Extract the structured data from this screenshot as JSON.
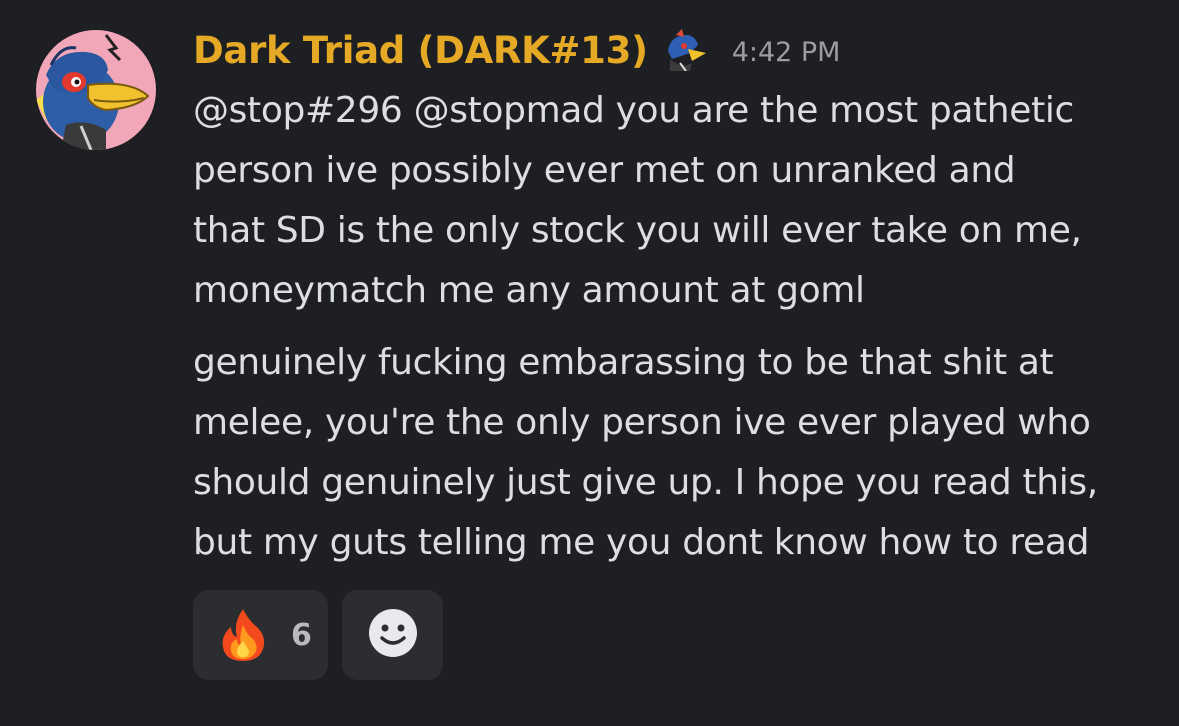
{
  "message": {
    "author": "Dark Triad (DARK#13)",
    "author_color": "#e5a926",
    "author_badge_icon": "falco-icon",
    "avatar_icon": "falco-avatar",
    "timestamp": "4:42 PM",
    "paragraphs": [
      {
        "lines": [
          "@stop#296 @stopmad you are the most pathetic",
          "person ive possibly ever met on unranked and",
          "that SD is the only stock you will ever take on me,",
          "moneymatch me any amount at goml"
        ]
      },
      {
        "lines": [
          "genuinely fucking embarassing to be that shit at",
          "melee, you're the only person ive ever played who",
          "should genuinely just give up. I hope you read this,",
          "but my guts telling me you dont know how to read"
        ]
      }
    ]
  },
  "reactions": [
    {
      "emoji": "fire-emoji",
      "count": "6"
    }
  ],
  "add_reaction_icon": "add-reaction-smiley-icon"
}
